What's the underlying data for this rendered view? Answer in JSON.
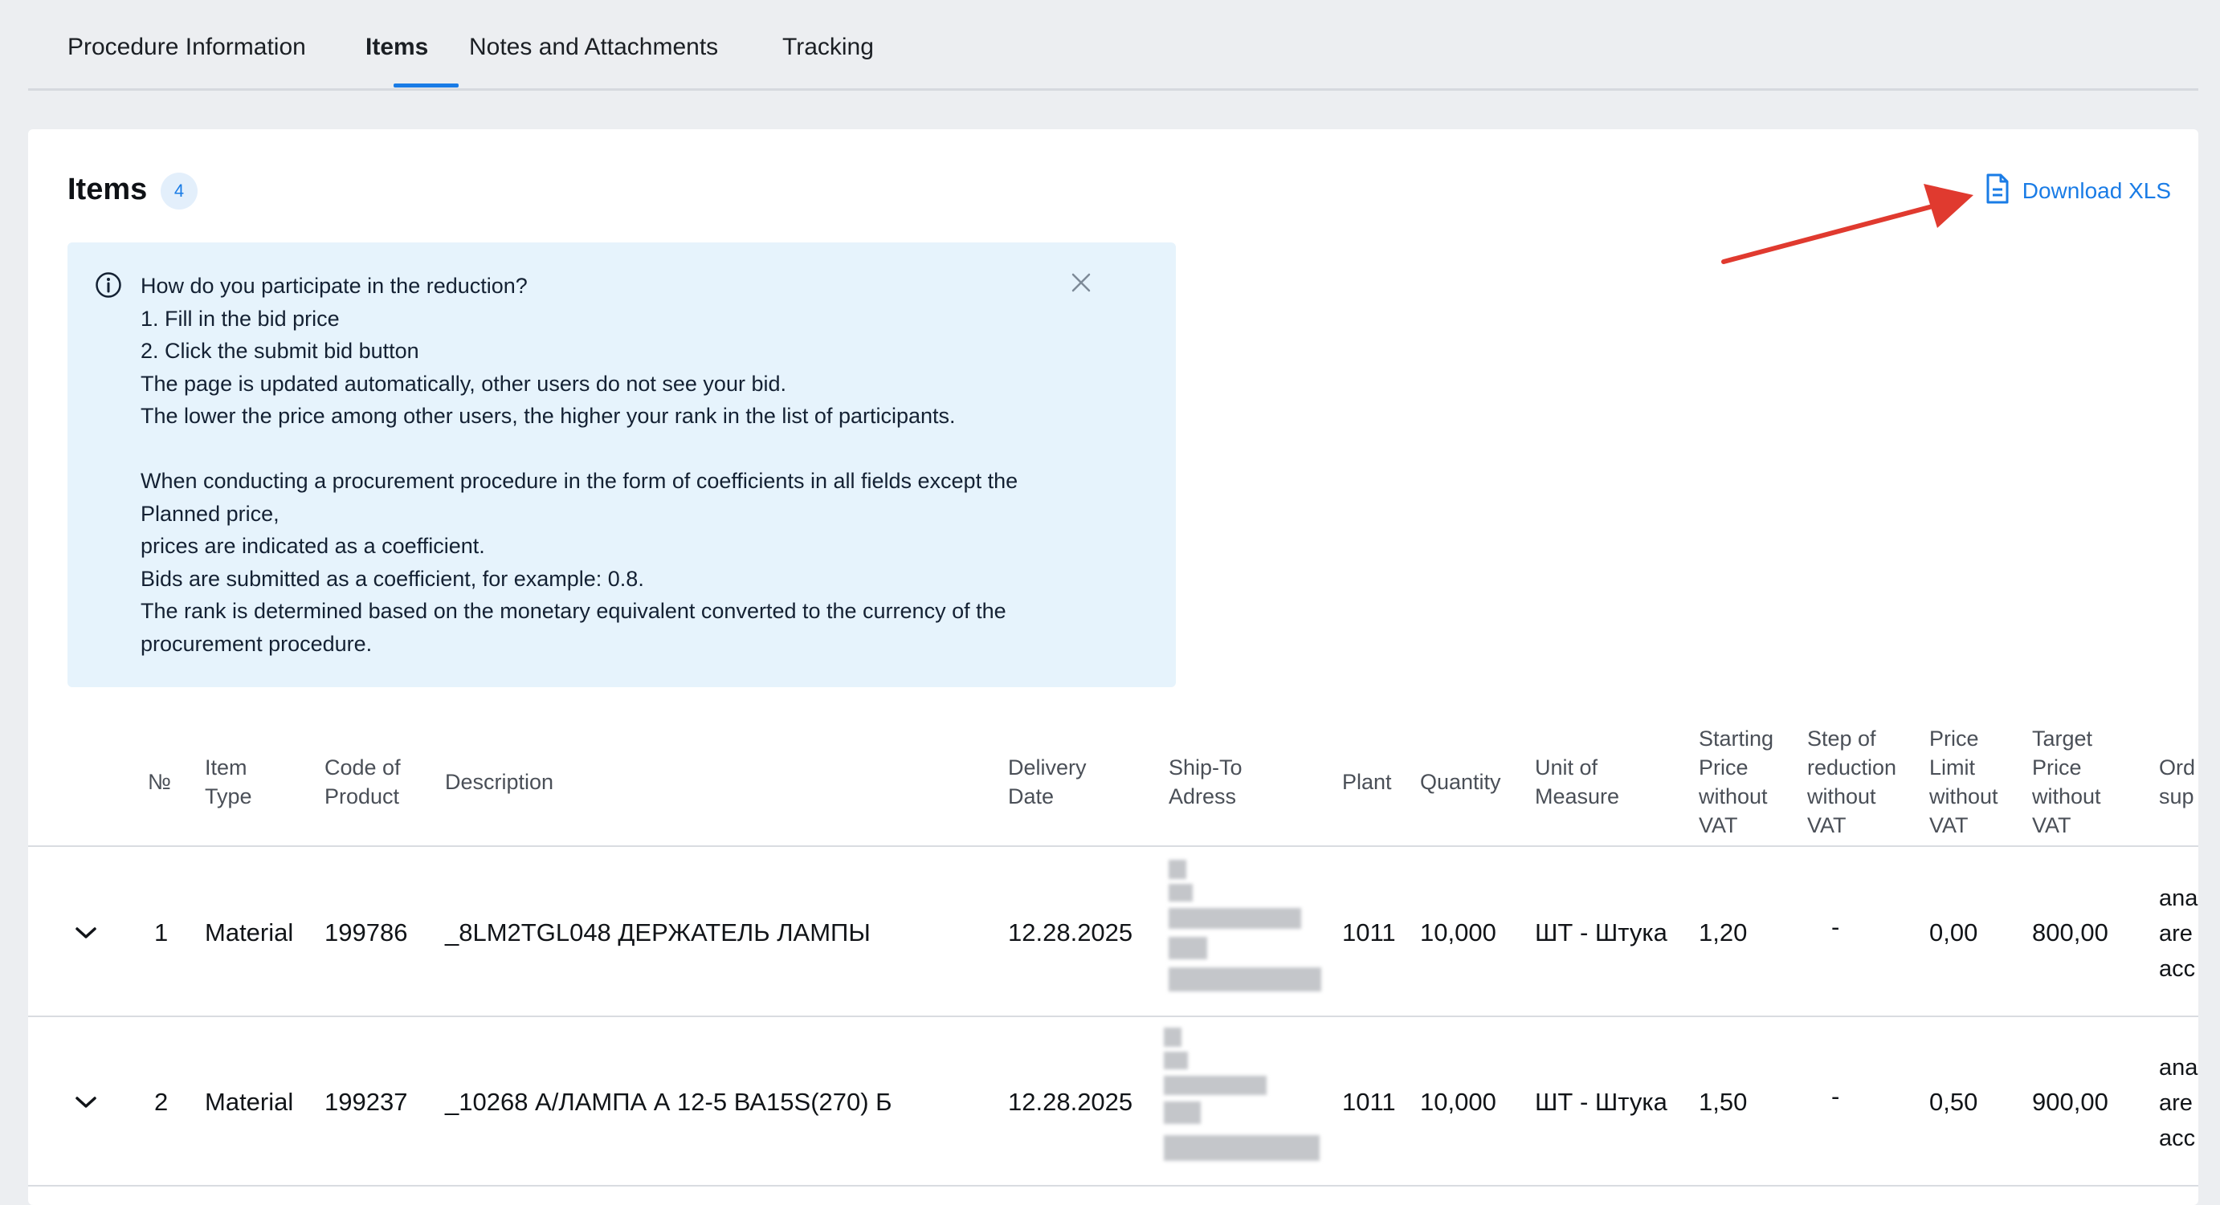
{
  "tabs": [
    {
      "label": "Procedure Information"
    },
    {
      "label": "Items"
    },
    {
      "label": "Notes and Attachments"
    },
    {
      "label": "Tracking"
    }
  ],
  "items_card": {
    "title": "Items",
    "count": "4",
    "download_label": "Download XLS"
  },
  "info": {
    "lines": [
      "How do you participate in the reduction?",
      "1. Fill in the bid price",
      "2. Click the submit bid button",
      "The page is updated automatically, other users do not see your bid.",
      "The lower the price among other users, the higher your rank in the list of participants.",
      "",
      "When conducting a procurement procedure in the form of coefficients in all fields except the",
      "Planned price,",
      "prices are indicated as a coefficient.",
      "Bids are submitted as a coefficient, for example: 0.8.",
      "The rank is determined based on the monetary equivalent converted to the currency of the",
      "procurement procedure."
    ]
  },
  "table": {
    "headers": {
      "num": "№",
      "item_type": [
        "Item",
        "Type"
      ],
      "code": [
        "Code of",
        "Product"
      ],
      "description": "Description",
      "delivery": [
        "Delivery",
        "Date"
      ],
      "shipto": [
        "Ship-To",
        "Adress"
      ],
      "plant": "Plant",
      "quantity": "Quantity",
      "uom": [
        "Unit of",
        "Measure"
      ],
      "start_price": [
        "Starting",
        "Price",
        "without",
        "VAT"
      ],
      "step": [
        "Step of",
        "reduction",
        "without",
        "VAT"
      ],
      "limit": [
        "Price",
        "Limit",
        "without",
        "VAT"
      ],
      "target": [
        "Target",
        "Price",
        "without",
        "VAT"
      ],
      "ord": [
        "Ord",
        "sup"
      ]
    },
    "rows": [
      {
        "num": "1",
        "item_type": "Material",
        "code": "199786",
        "description": "_8LM2TGL048 ДЕРЖАТЕЛЬ ЛАМПЫ",
        "delivery": "12.28.2025",
        "plant": "1011",
        "quantity": "10,000",
        "uom": "ШТ - Штука",
        "start_price": "1,20",
        "step": "-",
        "limit": "0,00",
        "target": "800,00",
        "ord": [
          "ana",
          "are",
          "acc"
        ]
      },
      {
        "num": "2",
        "item_type": "Material",
        "code": "199237",
        "description": "_10268 А/ЛАМПА А 12-5 ВА15S(270) Б",
        "delivery": "12.28.2025",
        "plant": "1011",
        "quantity": "10,000",
        "uom": "ШТ - Штука",
        "start_price": "1,50",
        "step": "-",
        "limit": "0,50",
        "target": "900,00",
        "ord": [
          "ana",
          "are",
          "acc"
        ]
      }
    ]
  },
  "colors": {
    "accent": "#1a7ce6",
    "info_bg": "#e6f3fc",
    "annotation_arrow": "#e03a2f"
  }
}
